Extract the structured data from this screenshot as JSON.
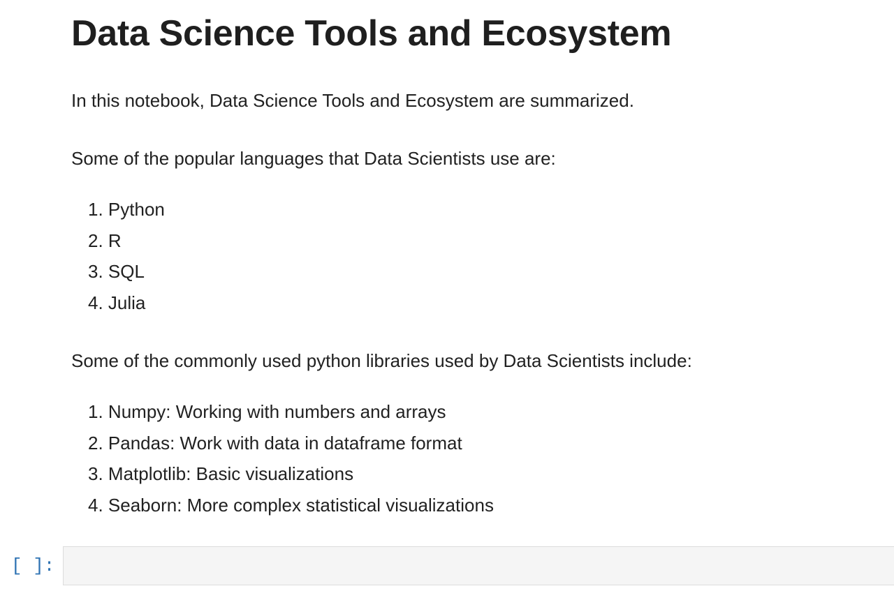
{
  "notebook": {
    "title": "Data Science Tools and Ecosystem",
    "intro": "In this notebook, Data Science Tools and Ecosystem are summarized.",
    "languages_heading": "Some of the popular languages that Data Scientists use are:",
    "languages": [
      {
        "num": "1.",
        "text": "Python"
      },
      {
        "num": "2.",
        "text": "R"
      },
      {
        "num": "3.",
        "text": "SQL"
      },
      {
        "num": "4.",
        "text": "Julia"
      }
    ],
    "libraries_heading": "Some of the commonly used python libraries used by Data Scientists include:",
    "libraries": [
      {
        "num": "1.",
        "text": "Numpy: Working with numbers and arrays"
      },
      {
        "num": "2.",
        "text": "Pandas: Work with data in dataframe format"
      },
      {
        "num": "3.",
        "text": "Matplotlib: Basic visualizations"
      },
      {
        "num": "4.",
        "text": "Seaborn: More complex statistical visualizations"
      }
    ]
  },
  "code_cell": {
    "prompt": "[ ]:",
    "content": ""
  }
}
